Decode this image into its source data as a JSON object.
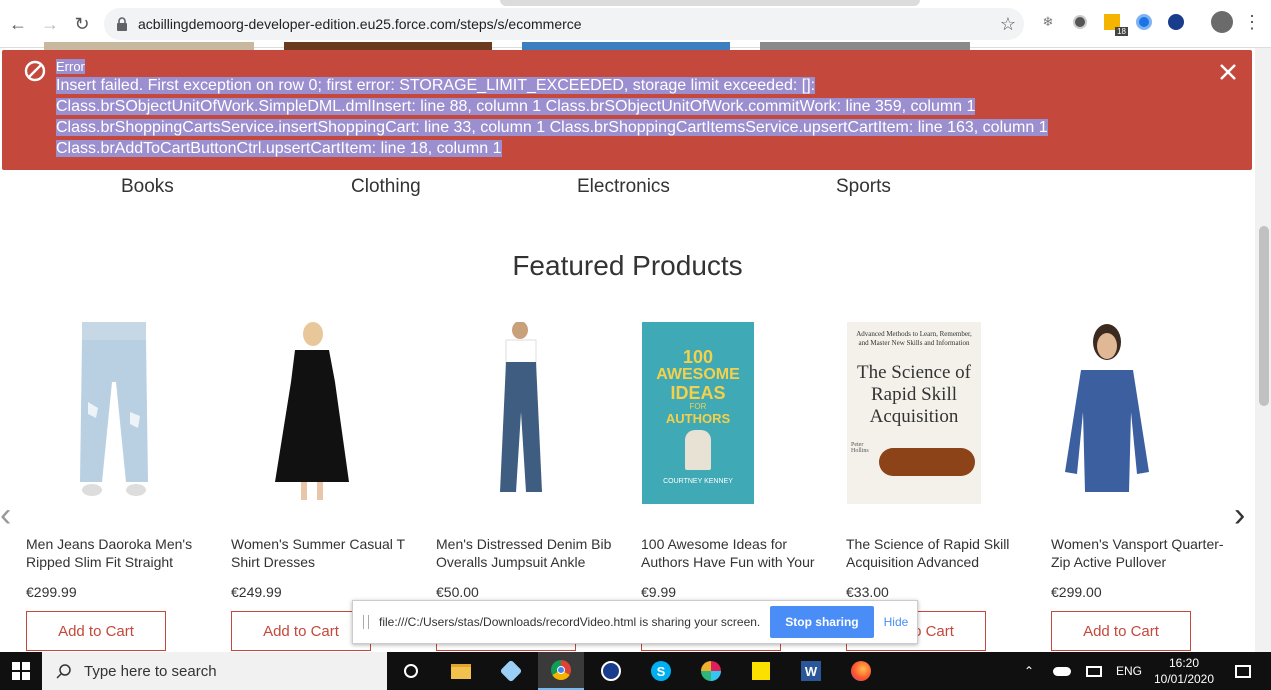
{
  "browser": {
    "url": "acbillingdemoorg-developer-edition.eu25.force.com/steps/s/ecommerce",
    "badge_count": "18"
  },
  "toast": {
    "title": "Error",
    "line1": "Insert failed. First exception on row 0; first error: STORAGE_LIMIT_EXCEEDED, storage limit exceeded: []:",
    "line2": "Class.brSObjectUnitOfWork.SimpleDML.dmlInsert: line 88, column 1 Class.brSObjectUnitOfWork.commitWork: line 359, column 1",
    "line3": "Class.brShoppingCartsService.insertShoppingCart: line 33, column 1 Class.brShoppingCartItemsService.upsertCartItem: line 163, column 1",
    "line4": "Class.brAddToCartButtonCtrl.upsertCartItem: line 18, column 1",
    "color": "#c4483b"
  },
  "categories": [
    "Books",
    "Clothing",
    "Electronics",
    "Sports"
  ],
  "heading": "Featured Products",
  "products": [
    {
      "name_line1": "Men Jeans Daoroka Men's",
      "name_line2": "Ripped Slim Fit Straight",
      "price": "€299.99",
      "button": "Add to Cart"
    },
    {
      "name_line1": "Women's Summer Casual T",
      "name_line2": "Shirt Dresses",
      "price": "€249.99",
      "button": "Add to Cart"
    },
    {
      "name_line1": "Men's Distressed Denim Bib",
      "name_line2": "Overalls Jumpsuit Ankle",
      "price": "€50.00",
      "button": "Add to Cart"
    },
    {
      "name_line1": "100 Awesome Ideas for",
      "name_line2": "Authors Have Fun with Your",
      "price": "€9.99",
      "button": "Add to Cart"
    },
    {
      "name_line1": "The Science of Rapid Skill",
      "name_line2": "Acquisition Advanced",
      "price": "€33.00",
      "button": "Add to Cart"
    },
    {
      "name_line1": "Women's Vansport Quarter-",
      "name_line2": "Zip Active Pullover",
      "price": "€299.00",
      "button": "Add to Cart"
    }
  ],
  "book1": {
    "l1": "100",
    "l2": "AWESOME",
    "l3": "IDEAS",
    "l4": "FOR",
    "l5": "AUTHORS",
    "author": "COURTNEY KENNEY"
  },
  "book2": {
    "top": "Advanced Methods to Learn, Remember, and Master New Skills and Information",
    "t1": "The Science of",
    "t2": "Rapid Skill",
    "t3": "Acquisition",
    "author": "Peter Hollins"
  },
  "sharing": {
    "text": "file:///C:/Users/stas/Downloads/recordVideo.html is sharing your screen.",
    "stop": "Stop sharing",
    "hide": "Hide"
  },
  "taskbar": {
    "search_placeholder": "Type here to search",
    "lang": "ENG",
    "time": "16:20",
    "date": "10/01/2020"
  }
}
